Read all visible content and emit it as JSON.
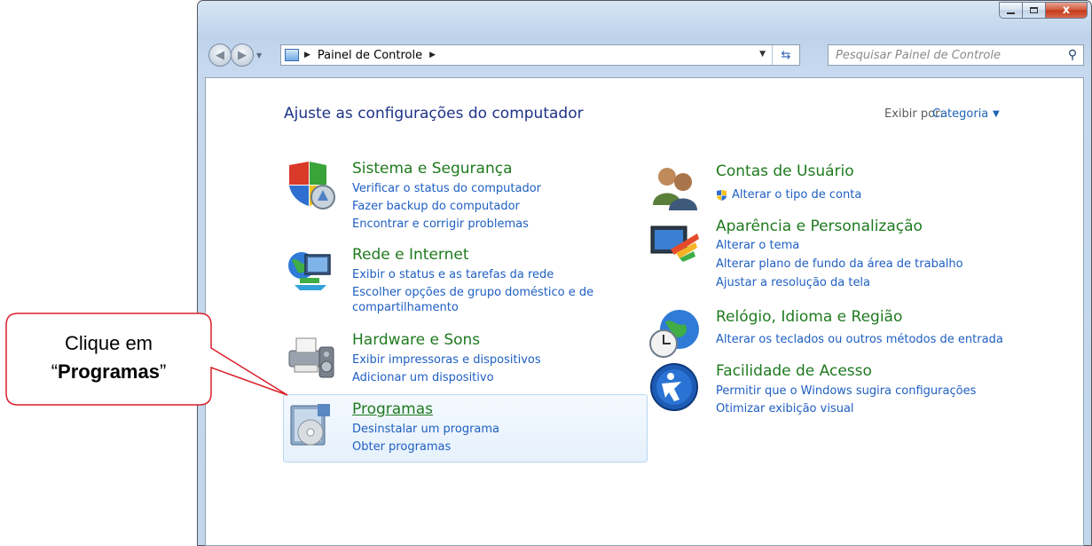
{
  "window": {
    "caption_min": "",
    "caption_max": "",
    "caption_close": "x"
  },
  "toolbar": {
    "breadcrumb_root": "Painel de Controle",
    "search_placeholder": "Pesquisar Painel de Controle"
  },
  "page": {
    "title": "Ajuste as configurações do computador",
    "view_by_label": "Exibir por:",
    "view_by_value": "Categoria"
  },
  "categories_left": [
    {
      "title": "Sistema e Segurança",
      "icon": "shield-security-icon",
      "links": [
        "Verificar o status do computador",
        "Fazer backup do computador",
        "Encontrar e corrigir problemas"
      ]
    },
    {
      "title": "Rede e Internet",
      "icon": "network-globe-icon",
      "links": [
        "Exibir o status e as tarefas da rede",
        "Escolher opções de grupo doméstico e de",
        "compartilhamento"
      ]
    },
    {
      "title": "Hardware e Sons",
      "icon": "printer-speaker-icon",
      "links": [
        "Exibir impressoras e dispositivos",
        "Adicionar um dispositivo"
      ]
    },
    {
      "title": "Programas",
      "icon": "programs-disc-icon",
      "links": [
        "Desinstalar um programa",
        "Obter programas"
      ]
    }
  ],
  "categories_right": [
    {
      "title": "Contas de Usuário",
      "icon": "users-icon",
      "links": [
        "Alterar o tipo de conta"
      ]
    },
    {
      "title": "Aparência e Personalização",
      "icon": "monitor-brush-icon",
      "links": [
        "Alterar o tema",
        "Alterar plano de fundo da área de trabalho",
        "Ajustar a resolução da tela"
      ]
    },
    {
      "title": "Relógio, Idioma e Região",
      "icon": "clock-globe-icon",
      "links": [
        "Alterar os teclados ou outros métodos de entrada"
      ]
    },
    {
      "title": "Facilidade de Acesso",
      "icon": "accessibility-icon",
      "links": [
        "Permitir que o Windows sugira configurações",
        "Otimizar exibição visual"
      ]
    }
  ],
  "callout": {
    "line1": "Clique em",
    "quote_open": "“",
    "bold": "Programas",
    "quote_close": "”"
  },
  "colors": {
    "title_green": "#1f7a1f",
    "link_blue": "#1e5fc2",
    "heading_blue": "#1e3287",
    "callout_border": "#d9202a"
  }
}
